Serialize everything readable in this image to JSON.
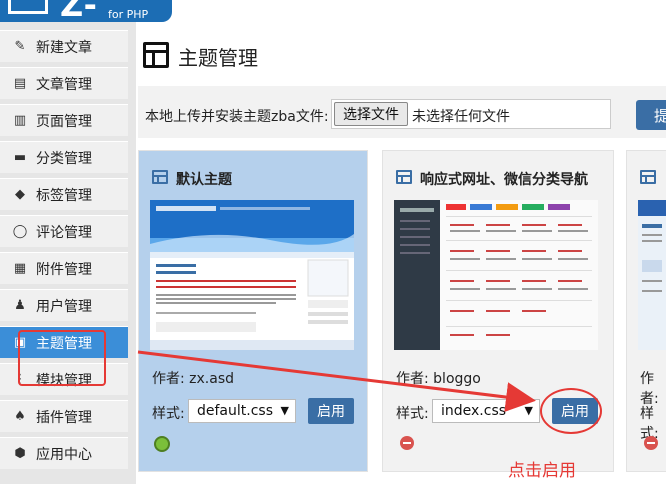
{
  "brand": {
    "logo_text": "Z-Blog",
    "logo_sub": "for PHP"
  },
  "sidebar": {
    "items": [
      {
        "label": "新建文章",
        "icon": "edit-icon"
      },
      {
        "label": "文章管理",
        "icon": "document-icon"
      },
      {
        "label": "页面管理",
        "icon": "page-icon"
      },
      {
        "label": "分类管理",
        "icon": "folder-icon"
      },
      {
        "label": "标签管理",
        "icon": "tag-icon"
      },
      {
        "label": "评论管理",
        "icon": "comment-icon"
      },
      {
        "label": "附件管理",
        "icon": "attachment-icon"
      },
      {
        "label": "用户管理",
        "icon": "user-icon"
      },
      {
        "label": "主题管理",
        "icon": "theme-icon",
        "active": true
      },
      {
        "label": "模块管理",
        "icon": "module-icon"
      },
      {
        "label": "插件管理",
        "icon": "plugin-icon"
      },
      {
        "label": "应用中心",
        "icon": "app-center-icon"
      }
    ]
  },
  "main": {
    "page_title": "主题管理",
    "upload": {
      "label": "本地上传并安装主题zba文件:",
      "choose_button": "选择文件",
      "no_file": "未选择任何文件",
      "submit": "提"
    }
  },
  "themes": [
    {
      "name": "默认主题",
      "author_label": "作者:",
      "author": "zx.asd",
      "style_label": "样式:",
      "style": "default.css",
      "enable": "启用",
      "active": true
    },
    {
      "name": "响应式网址、微信分类导航",
      "author_label": "作者:",
      "author": "bloggo",
      "style_label": "样式:",
      "style": "index.css",
      "enable": "启用"
    },
    {
      "name": "",
      "author_label": "作者:",
      "style_label": "样式:"
    }
  ],
  "annotation": {
    "text": "点击启用",
    "color": "#e53935"
  },
  "colors": {
    "accent": "#3a6ea5",
    "active_nav": "#3b8ed8",
    "active_card": "#b5d0ec"
  }
}
